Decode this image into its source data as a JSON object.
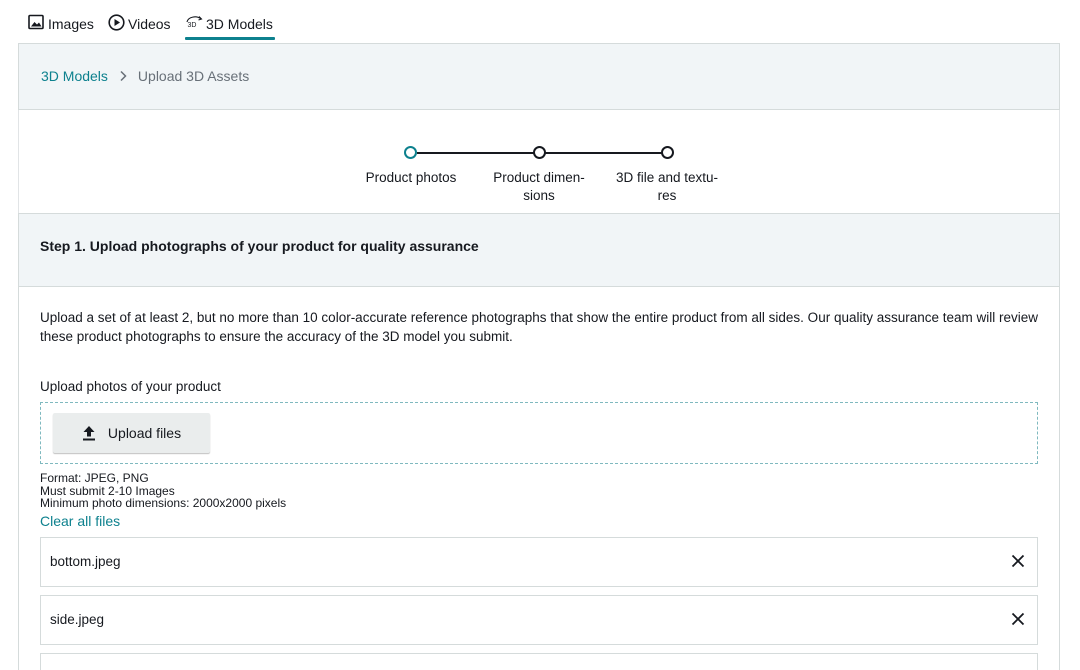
{
  "tabs": [
    {
      "label": "Images",
      "icon": "image-icon"
    },
    {
      "label": "Videos",
      "icon": "play-circle-icon"
    },
    {
      "label": "3D Models",
      "icon": "3d-rotate-icon",
      "icon_text": "3D"
    }
  ],
  "breadcrumb": {
    "parent": "3D Models",
    "current": "Upload 3D Assets"
  },
  "stepper": {
    "steps": [
      {
        "label_line1": "Product photos",
        "label_line2": ""
      },
      {
        "label_line1": "Product dimen-",
        "label_line2": "sions"
      },
      {
        "label_line1": "3D file and textu-",
        "label_line2": "res"
      }
    ]
  },
  "step_card": {
    "title": "Step 1. Upload photographs of your product for quality assurance",
    "description": "Upload a set of at least 2, but no more than 10 color-accurate reference photographs that show the entire product from all sides. Our quality assurance team will review these product photographs to ensure the accuracy of the 3D model you submit.",
    "upload_label": "Upload photos of your product",
    "upload_button": "Upload files",
    "help_lines": [
      "Format: JPEG, PNG",
      "Must submit 2-10 Images",
      "Minimum photo dimensions: 2000x2000 pixels"
    ],
    "clear_all": "Clear all files",
    "files": [
      {
        "name": "bottom.jpeg"
      },
      {
        "name": "side.jpeg"
      },
      {
        "name": ""
      }
    ]
  },
  "colors": {
    "accent": "#0d818e",
    "header_bg": "#f1f5f7",
    "border": "#d5dbdb"
  }
}
